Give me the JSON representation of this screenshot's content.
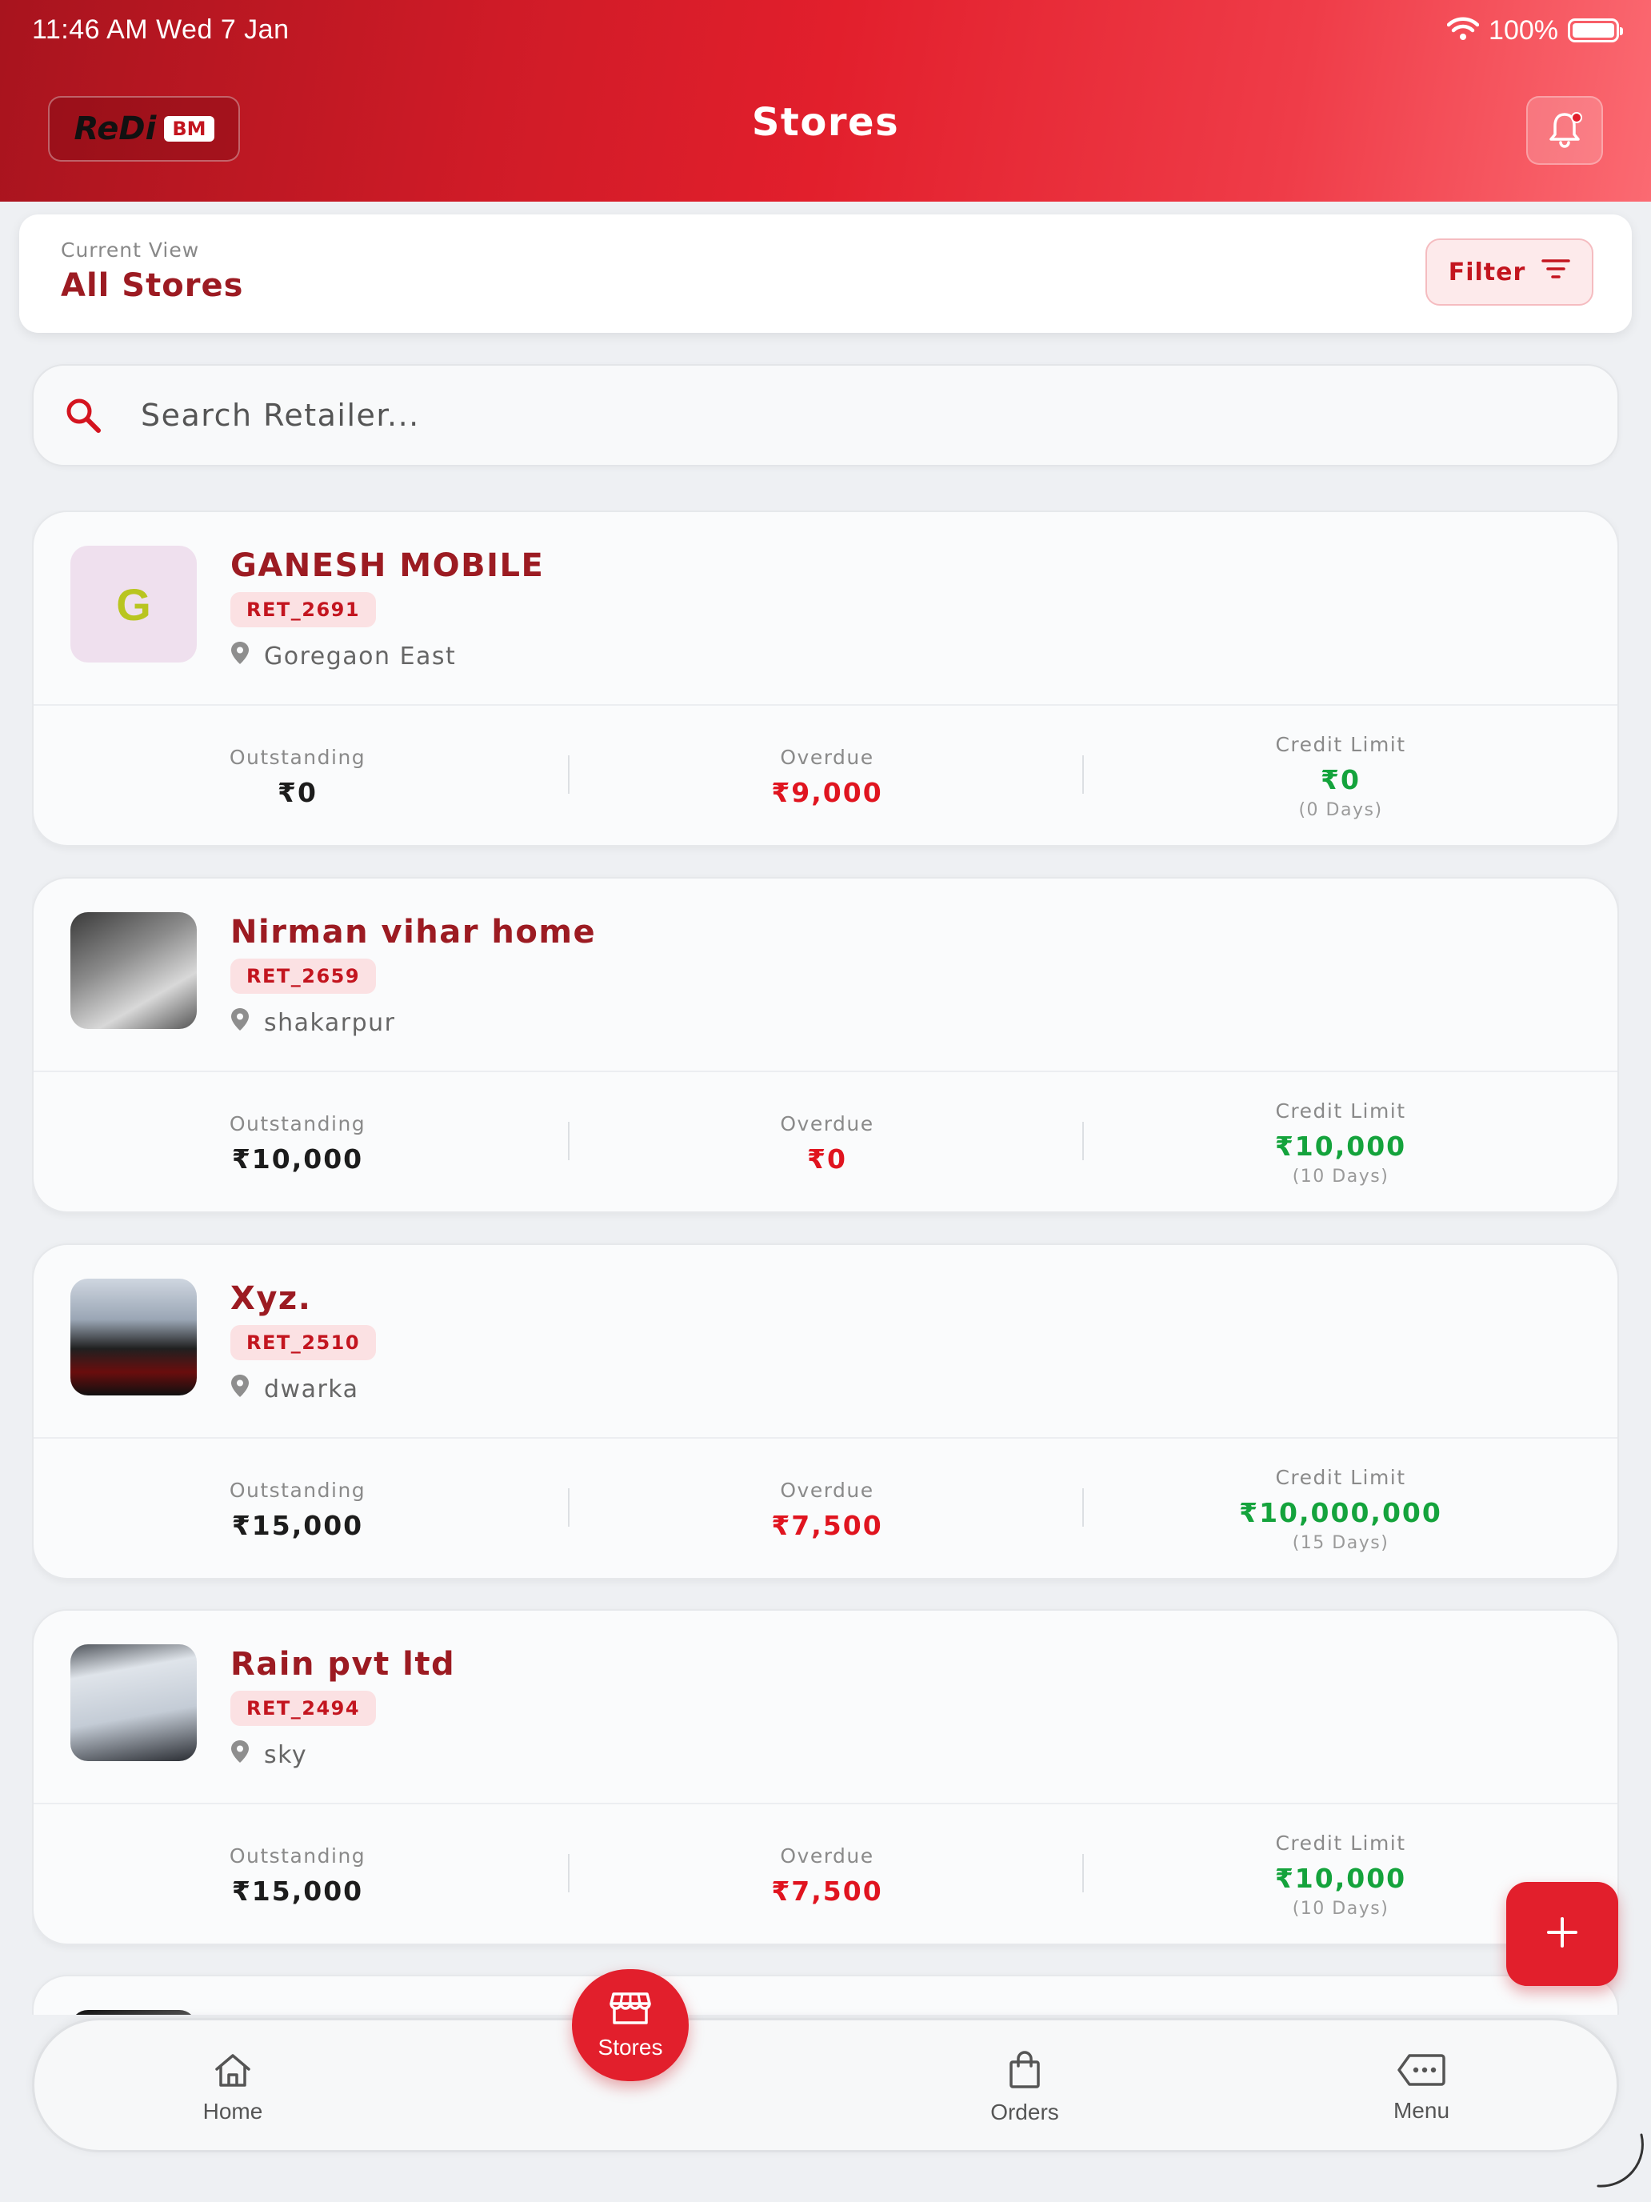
{
  "status_bar": {
    "time_date": "11:46 AM   Wed 7 Jan",
    "battery_pct": "100%",
    "battery_level": 1.0
  },
  "header": {
    "logo_text": "ReDi",
    "logo_badge": "BM",
    "title": "Stores"
  },
  "current_view": {
    "caption": "Current View",
    "value": "All Stores",
    "filter_label": "Filter"
  },
  "search": {
    "placeholder": "Search Retailer..."
  },
  "stores": [
    {
      "name": "GANESH MOBILE",
      "code": "RET_2691",
      "location": "Goregaon East",
      "avatar_letter": "G",
      "outstanding_label": "Outstanding",
      "outstanding": "₹0",
      "overdue_label": "Overdue",
      "overdue": "₹9,000",
      "credit_label": "Credit Limit",
      "credit_limit": "₹0",
      "credit_days": "(0 Days)"
    },
    {
      "name": "Nirman vihar home",
      "code": "RET_2659",
      "location": "shakarpur",
      "outstanding_label": "Outstanding",
      "outstanding": "₹10,000",
      "overdue_label": "Overdue",
      "overdue": "₹0",
      "credit_label": "Credit Limit",
      "credit_limit": "₹10,000",
      "credit_days": "(10 Days)"
    },
    {
      "name": "Xyz.",
      "code": "RET_2510",
      "location": "dwarka",
      "outstanding_label": "Outstanding",
      "outstanding": "₹15,000",
      "overdue_label": "Overdue",
      "overdue": "₹7,500",
      "credit_label": "Credit Limit",
      "credit_limit": "₹10,000,000",
      "credit_days": "(15 Days)"
    },
    {
      "name": "Rain pvt ltd",
      "code": "RET_2494",
      "location": "sky",
      "outstanding_label": "Outstanding",
      "outstanding": "₹15,000",
      "overdue_label": "Overdue",
      "overdue": "₹7,500",
      "credit_label": "Credit Limit",
      "credit_limit": "₹10,000",
      "credit_days": "(10 Days)"
    }
  ],
  "fab": {
    "icon": "plus-icon"
  },
  "nav": {
    "home": "Home",
    "stores": "Stores",
    "orders": "Orders",
    "menu": "Menu"
  },
  "colors": {
    "brand_red": "#e21f2c",
    "title_red": "#9c1b22",
    "overdue_red": "#e0141f",
    "credit_green": "#14a33c"
  }
}
